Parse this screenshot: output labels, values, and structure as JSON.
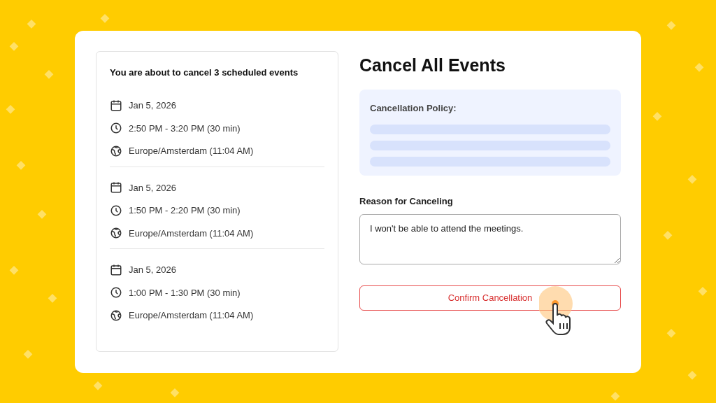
{
  "summary": {
    "heading": "You are about to cancel 3 scheduled events",
    "events": [
      {
        "date": "Jan 5, 2026",
        "time": "2:50 PM - 3:20 PM (30 min)",
        "timezone": "Europe/Amsterdam (11:04 AM)"
      },
      {
        "date": "Jan 5, 2026",
        "time": "1:50 PM - 2:20 PM (30 min)",
        "timezone": "Europe/Amsterdam (11:04 AM)"
      },
      {
        "date": "Jan 5, 2026",
        "time": "1:00 PM - 1:30 PM (30 min)",
        "timezone": "Europe/Amsterdam (11:04 AM)"
      }
    ]
  },
  "title": "Cancel All Events",
  "policy": {
    "label": "Cancellation Policy:"
  },
  "reason": {
    "label": "Reason for Canceling",
    "value": "I won't be able to attend the meetings."
  },
  "confirm_button": {
    "label": "Confirm Cancellation"
  }
}
